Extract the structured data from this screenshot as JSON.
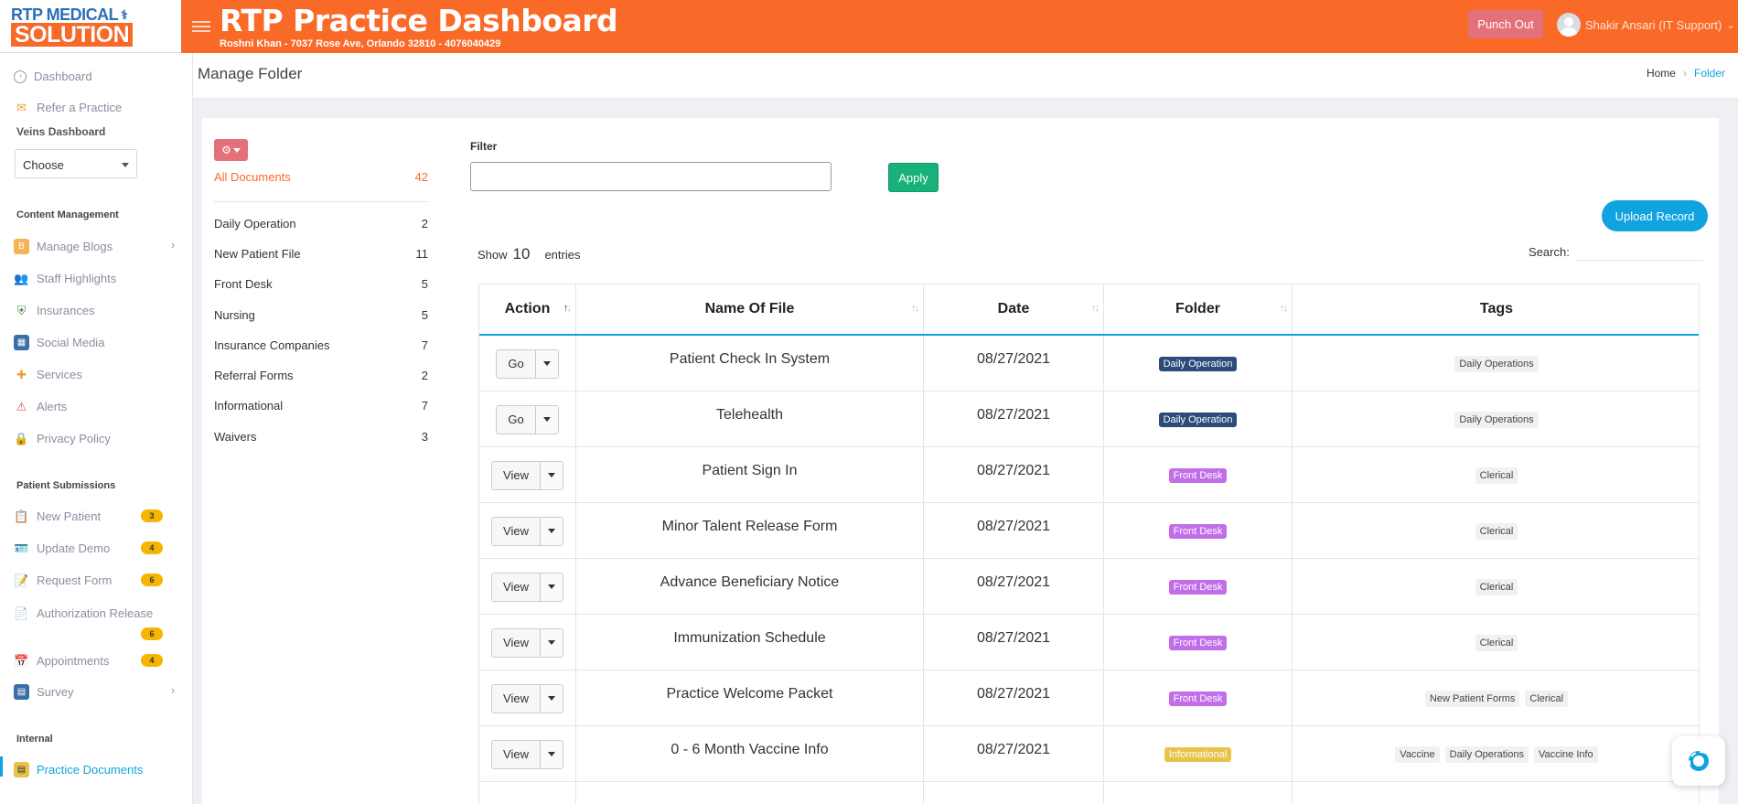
{
  "header": {
    "logo_top": "RTP MEDICAL",
    "logo_bottom": "SOLUTION",
    "title": "RTP Practice Dashboard",
    "subtitle": "Roshni Khan - 7037 Rose Ave, Orlando 32810 - 4076040429",
    "punch_out": "Punch Out",
    "user_name": "Shakir Ansari (IT Support)"
  },
  "sidebar": {
    "dashboard": "Dashboard",
    "refer": "Refer a Practice",
    "veins_heading": "Veins Dashboard",
    "choose": "Choose",
    "content_heading": "Content Management",
    "content_items": [
      "Manage Blogs",
      "Staff Highlights",
      "Insurances",
      "Social Media",
      "Services",
      "Alerts",
      "Privacy Policy"
    ],
    "patient_heading": "Patient Submissions",
    "patient_items": [
      {
        "label": "New Patient",
        "count": "3"
      },
      {
        "label": "Update Demo",
        "count": "4"
      },
      {
        "label": "Request Form",
        "count": "6"
      },
      {
        "label": "Authorization Release",
        "count": "6"
      },
      {
        "label": "Appointments",
        "count": "4"
      },
      {
        "label": "Survey",
        "count": ""
      }
    ],
    "internal_heading": "Internal",
    "practice_documents": "Practice Documents"
  },
  "page": {
    "title": "Manage Folder",
    "breadcrumb_home": "Home",
    "breadcrumb_current": "Folder"
  },
  "folders": {
    "all_label": "All Documents",
    "all_count": "42",
    "items": [
      {
        "label": "Daily Operation",
        "count": "2"
      },
      {
        "label": "New Patient File",
        "count": "11"
      },
      {
        "label": "Front Desk",
        "count": "5"
      },
      {
        "label": "Nursing",
        "count": "5"
      },
      {
        "label": "Insurance Companies",
        "count": "7"
      },
      {
        "label": "Referral Forms",
        "count": "2"
      },
      {
        "label": "Informational",
        "count": "7"
      },
      {
        "label": "Waivers",
        "count": "3"
      }
    ]
  },
  "filter": {
    "label": "Filter",
    "value": "",
    "apply": "Apply"
  },
  "upload_label": "Upload Record",
  "table_controls": {
    "show": "Show",
    "entries_value": "10",
    "entries": "entries",
    "search": "Search:"
  },
  "table": {
    "columns": [
      "Action",
      "Name Of File",
      "Date",
      "Folder",
      "Tags"
    ],
    "rows": [
      {
        "action": "Go",
        "name": "Patient Check In System",
        "date": "08/27/2021",
        "folder": "Daily Operation",
        "tags": [
          "Daily Operations"
        ]
      },
      {
        "action": "Go",
        "name": "Telehealth",
        "date": "08/27/2021",
        "folder": "Daily Operation",
        "tags": [
          "Daily Operations"
        ]
      },
      {
        "action": "View",
        "name": "Patient Sign In",
        "date": "08/27/2021",
        "folder": "Front Desk",
        "tags": [
          "Clerical"
        ]
      },
      {
        "action": "View",
        "name": "Minor Talent Release Form",
        "date": "08/27/2021",
        "folder": "Front Desk",
        "tags": [
          "Clerical"
        ]
      },
      {
        "action": "View",
        "name": "Advance Beneficiary Notice",
        "date": "08/27/2021",
        "folder": "Front Desk",
        "tags": [
          "Clerical"
        ]
      },
      {
        "action": "View",
        "name": "Immunization Schedule",
        "date": "08/27/2021",
        "folder": "Front Desk",
        "tags": [
          "Clerical"
        ]
      },
      {
        "action": "View",
        "name": "Practice Welcome Packet",
        "date": "08/27/2021",
        "folder": "Front Desk",
        "tags": [
          "New Patient Forms",
          "Clerical"
        ]
      },
      {
        "action": "View",
        "name": "0 - 6 Month Vaccine Info",
        "date": "08/27/2021",
        "folder": "Informational",
        "tags": [
          "Vaccine",
          "Daily Operations",
          "Vaccine Info"
        ]
      }
    ]
  },
  "colors": {
    "brand_orange": "#f96a28",
    "accent_blue": "#10a3df",
    "daily_operation": "#2c4a7a",
    "front_desk": "#c16ee8",
    "informational": "#e8c24a",
    "apply_green": "#18b17a",
    "badge_yellow": "#f7b500"
  }
}
